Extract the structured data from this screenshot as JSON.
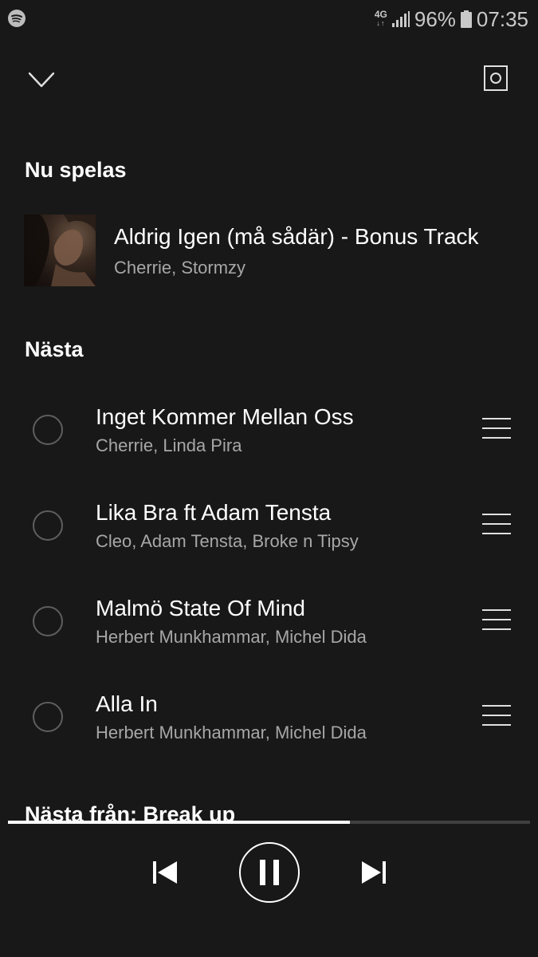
{
  "status_bar": {
    "network": "4G",
    "battery": "96%",
    "time": "07:35",
    "icons": [
      "spotify-icon",
      "signal-icon",
      "battery-icon"
    ]
  },
  "header": {
    "collapse_icon": "chevron-down-icon",
    "device_icon": "connect-device-icon"
  },
  "now_playing": {
    "heading": "Nu spelas",
    "title": "Aldrig Igen (må sådär) - Bonus Track",
    "artists": "Cherrie, Stormzy"
  },
  "next": {
    "heading": "Nästa",
    "items": [
      {
        "title": "Inget Kommer Mellan Oss",
        "artists": "Cherrie, Linda Pira"
      },
      {
        "title": "Lika Bra ft Adam Tensta",
        "artists": "Cleo, Adam Tensta, Broke n Tipsy"
      },
      {
        "title": "Malmö State Of Mind",
        "artists": "Herbert Munkhammar, Michel Dida"
      },
      {
        "title": "Alla In",
        "artists": "Herbert Munkhammar, Michel Dida"
      }
    ]
  },
  "next_from": {
    "heading": "Nästa från: Break up"
  },
  "player": {
    "progress": 0.655,
    "state": "playing",
    "controls": [
      "previous-icon",
      "pause-icon",
      "next-icon"
    ]
  },
  "colors": {
    "background": "#181818",
    "text_primary": "#ffffff",
    "text_secondary": "#a7a7a7",
    "progress_track": "#404040"
  }
}
